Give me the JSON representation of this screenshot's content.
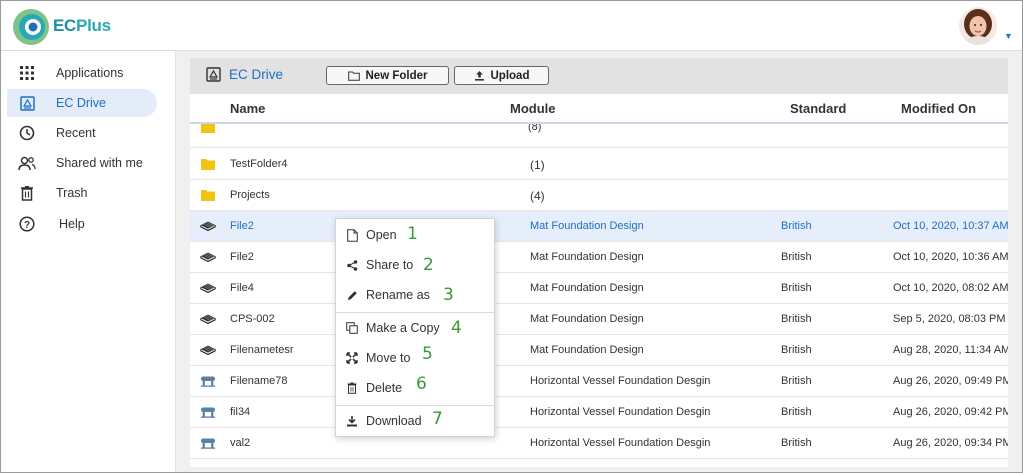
{
  "app": {
    "brand_prefix": "EC",
    "brand_suffix": "Plus"
  },
  "sidebar": {
    "items": [
      {
        "label": "Applications",
        "icon": "apps-grid-icon"
      },
      {
        "label": "EC Drive",
        "icon": "drive-icon",
        "active": true
      },
      {
        "label": "Recent",
        "icon": "clock-icon"
      },
      {
        "label": "Shared with me",
        "icon": "people-icon"
      },
      {
        "label": "Trash",
        "icon": "trash-icon"
      },
      {
        "label": "Help",
        "icon": "help-icon"
      }
    ]
  },
  "toolbar": {
    "title": "EC Drive",
    "new_folder_label": "New Folder",
    "upload_label": "Upload"
  },
  "table": {
    "columns": {
      "name": "Name",
      "module": "Module",
      "standard": "Standard",
      "modified": "Modified On"
    },
    "partial_row": {
      "module": "(8)"
    },
    "rows": [
      {
        "icon": "folder-icon",
        "name": "TestFolder4",
        "module": "(1)",
        "standard": "",
        "modified": ""
      },
      {
        "icon": "folder-icon",
        "name": "Projects",
        "module": "(4)",
        "standard": "",
        "modified": ""
      },
      {
        "icon": "mat-foundation-icon",
        "name": "File2",
        "module": "Mat Foundation Design",
        "standard": "British",
        "modified": "Oct 10, 2020, 10:37 AM",
        "selected": true
      },
      {
        "icon": "mat-foundation-icon",
        "name": "File2",
        "module": "Mat Foundation Design",
        "standard": "British",
        "modified": "Oct 10, 2020, 10:36 AM"
      },
      {
        "icon": "mat-foundation-icon",
        "name": "File4",
        "module": "Mat Foundation Design",
        "standard": "British",
        "modified": "Oct 10, 2020, 08:02 AM"
      },
      {
        "icon": "mat-foundation-icon",
        "name": "CPS-002",
        "module": "Mat Foundation Design",
        "standard": "British",
        "modified": "Sep 5, 2020, 08:03 PM"
      },
      {
        "icon": "mat-foundation-icon",
        "name": "Filenametesr",
        "module": "Mat Foundation Design",
        "standard": "British",
        "modified": "Aug 28, 2020, 11:34 AM"
      },
      {
        "icon": "vessel-foundation-icon",
        "name": "Filename78",
        "module": "Horizontal Vessel Foundation Desgin",
        "standard": "British",
        "modified": "Aug 26, 2020, 09:49 PM"
      },
      {
        "icon": "vessel-foundation-icon",
        "name": "fil34",
        "module": "Horizontal Vessel Foundation Desgin",
        "standard": "British",
        "modified": "Aug 26, 2020, 09:42 PM"
      },
      {
        "icon": "vessel-foundation-icon",
        "name": "val2",
        "module": "Horizontal Vessel Foundation Desgin",
        "standard": "British",
        "modified": "Aug 26, 2020, 09:34 PM"
      }
    ]
  },
  "context_menu": {
    "items": [
      {
        "label": "Open",
        "icon": "file-icon",
        "annotation": "1"
      },
      {
        "label": "Share to",
        "icon": "share-icon",
        "annotation": "2"
      },
      {
        "label": "Rename as",
        "icon": "pencil-icon",
        "annotation": "3"
      },
      {
        "label": "Make a Copy",
        "icon": "copy-icon",
        "annotation": "4"
      },
      {
        "label": "Move to",
        "icon": "move-icon",
        "annotation": "5"
      },
      {
        "label": "Delete",
        "icon": "trash-icon",
        "annotation": "6"
      },
      {
        "label": "Download",
        "icon": "download-icon",
        "annotation": "7"
      }
    ]
  },
  "colors": {
    "accent": "#1e6fc2",
    "brand": "#2aa8b4",
    "folder": "#f2c40f",
    "annotation": "#3a9a3a",
    "selected_row": "#e6eefb"
  }
}
